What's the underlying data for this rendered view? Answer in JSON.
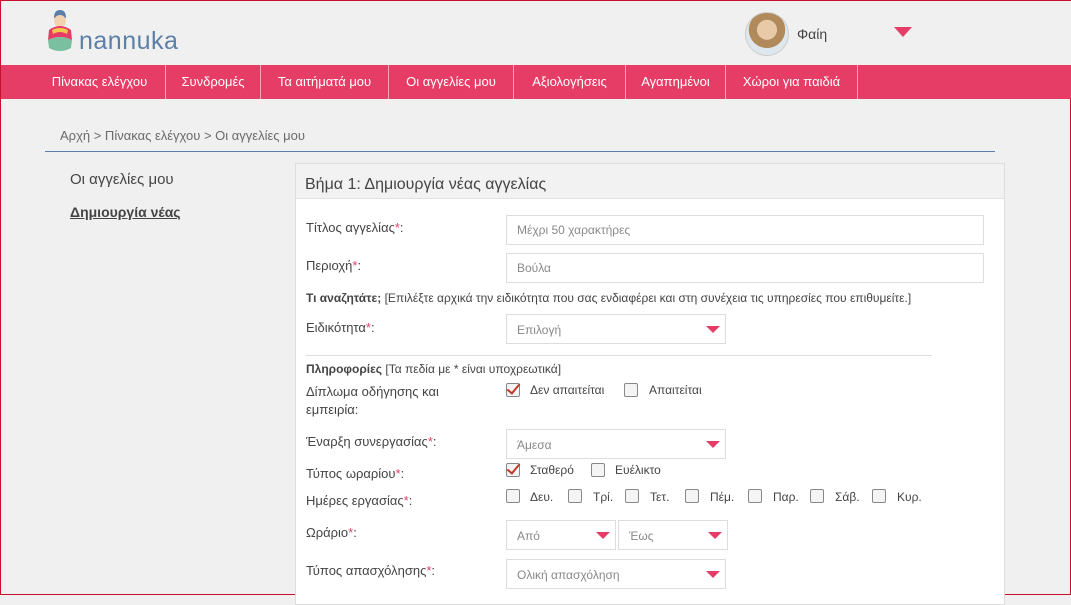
{
  "brand": {
    "name": "nannuka"
  },
  "user": {
    "name": "Φαίη"
  },
  "nav": [
    "Πίνακας ελέγχου",
    "Συνδρομές",
    "Τα αιτήματά μου",
    "Οι αγγελίες μου",
    "Αξιολογήσεις",
    "Αγαπημένοι",
    "Χώροι για παιδιά"
  ],
  "breadcrumb": "Αρχή > Πίνακας ελέγχου > Οι αγγελίες μου",
  "side": {
    "my_ads": "Οι αγγελίες μου",
    "create_new": "Δημιουργία νέας"
  },
  "panel": {
    "title": "Βήμα 1: Δημιουργία νέας αγγελίας"
  },
  "form": {
    "title_label": "Τίτλος αγγελίας",
    "title_placeholder": "Μέχρι 50 χαρακτήρες",
    "area_label": "Περιοχή",
    "area_placeholder": "Βούλα",
    "seeking_title": "Τι αναζητάτε;",
    "seeking_hint": "[Επιλέξτε αρχικά την ειδικότητα που σας ενδιαφέρει και στη συνέχεια τις υπηρεσίες που επιθυμείτε.]",
    "specialty_label": "Ειδικότητα",
    "specialty_value": "Επιλογή",
    "info_title": "Πληροφορίες",
    "info_hint": "[Τα πεδία με * είναι υποχρεωτικά]",
    "license_label_1": "Δίπλωμα οδήγησης και",
    "license_label_2": "εμπειρία:",
    "license_opt_1": "Δεν απαιτείται",
    "license_opt_2": "Απαιτείται",
    "start_label": "Έναρξη συνεργασίας",
    "start_value": "Άμεσα",
    "schedule_type_label": "Τύπος ωραρίου",
    "schedule_opt_1": "Σταθερό",
    "schedule_opt_2": "Ευέλικτο",
    "days_label": "Ημέρες εργασίας",
    "days": [
      "Δευ.",
      "Τρί.",
      "Τετ.",
      "Πέμ.",
      "Παρ.",
      "Σάβ.",
      "Κυρ."
    ],
    "hours_label": "Ωράριο",
    "hours_from": "Από",
    "hours_to": "Έως",
    "employment_label": "Τύπος απασχόλησης",
    "employment_value": "Ολική απασχόληση",
    "required_mark": "*",
    "colon": ":"
  },
  "colors": {
    "accent": "#e63d66",
    "brand_blue": "#5b7fa6"
  }
}
